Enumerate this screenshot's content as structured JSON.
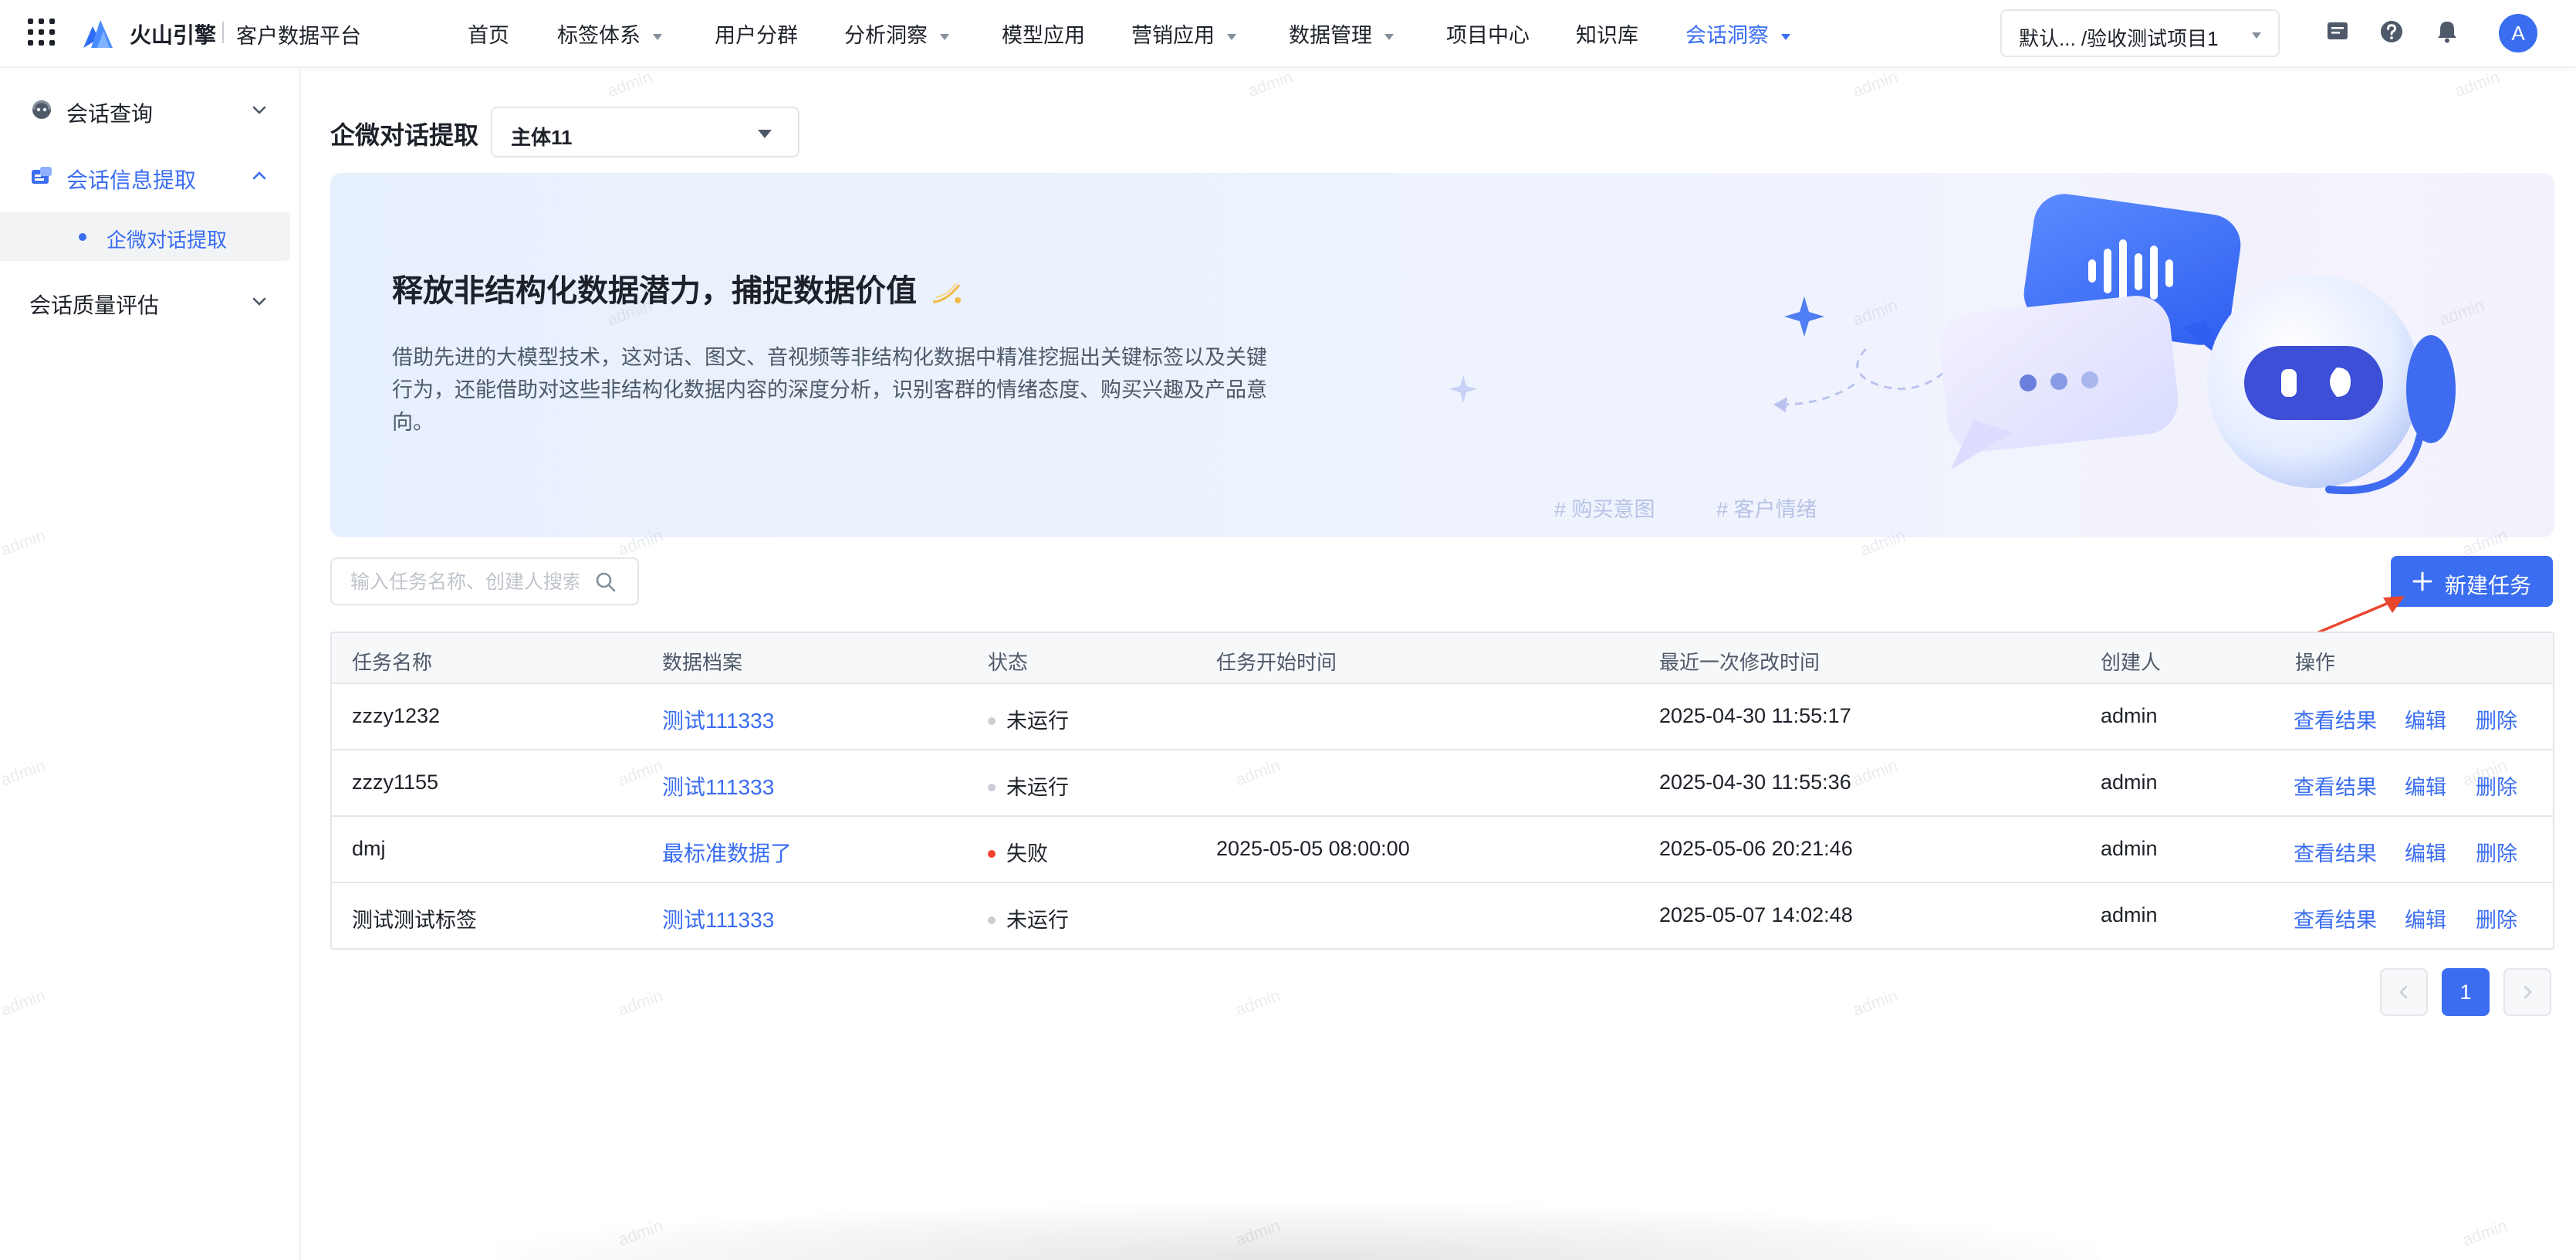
{
  "header": {
    "brand": "火山引擎",
    "platform": "客户数据平台",
    "nav": [
      {
        "label": "首页",
        "dropdown": false
      },
      {
        "label": "标签体系",
        "dropdown": true
      },
      {
        "label": "用户分群",
        "dropdown": false
      },
      {
        "label": "分析洞察",
        "dropdown": true
      },
      {
        "label": "模型应用",
        "dropdown": false
      },
      {
        "label": "营销应用",
        "dropdown": true
      },
      {
        "label": "数据管理",
        "dropdown": true
      },
      {
        "label": "项目中心",
        "dropdown": false
      },
      {
        "label": "知识库",
        "dropdown": false
      },
      {
        "label": "会话洞察",
        "dropdown": true,
        "active": true
      }
    ],
    "project": "默认... /验收测试项目1",
    "avatar": "A",
    "icons": [
      "apps-grid-icon",
      "volcano-logo-icon",
      "message-icon",
      "help-icon",
      "bell-icon"
    ]
  },
  "sidebar": {
    "groups": [
      {
        "label": "会话查询",
        "icon": "chat-headset-icon",
        "expanded": false
      },
      {
        "label": "会话信息提取",
        "icon": "info-extract-icon",
        "expanded": true,
        "children": [
          {
            "label": "企微对话提取",
            "selected": true
          }
        ]
      },
      {
        "label": "会话质量评估",
        "expanded": false
      }
    ]
  },
  "main": {
    "title": "企微对话提取",
    "entity_select": "主体11",
    "banner": {
      "title": "释放非结构化数据潜力，捕捉数据价值",
      "description": "借助先进的大模型技术，这对话、图文、音视频等非结构化数据中精准挖掘出关键标签以及关键行为，还能借助对这些非结构化数据内容的深度分析，识别客群的情绪态度、购买兴趣及产品意向。",
      "tags": [
        "# 购买意图",
        "# 客户情绪"
      ]
    },
    "search": {
      "placeholder": "输入任务名称、创建人搜索",
      "value": ""
    },
    "new_button": "新建任务",
    "table": {
      "columns": [
        "任务名称",
        "数据档案",
        "状态",
        "任务开始时间",
        "最近一次修改时间",
        "创建人",
        "操作"
      ],
      "rows": [
        {
          "name": "zzzy1232",
          "archive": "测试111333",
          "status": "未运行",
          "status_color": "#c9cdd4",
          "start": "",
          "modified": "2025-04-30 11:55:17",
          "creator": "admin"
        },
        {
          "name": "zzzy1155",
          "archive": "测试111333",
          "status": "未运行",
          "status_color": "#c9cdd4",
          "start": "",
          "modified": "2025-04-30 11:55:36",
          "creator": "admin"
        },
        {
          "name": "dmj",
          "archive": "最标准数据了",
          "status": "失败",
          "status_color": "#f5422d",
          "start": "2025-05-05 08:00:00",
          "modified": "2025-05-06 20:21:46",
          "creator": "admin"
        },
        {
          "name": "测试测试标签",
          "archive": "测试111333",
          "status": "未运行",
          "status_color": "#c9cdd4",
          "start": "",
          "modified": "2025-05-07 14:02:48",
          "creator": "admin"
        }
      ],
      "actions": [
        "查看结果",
        "编辑",
        "删除"
      ]
    },
    "pagination": {
      "current": "1"
    }
  },
  "watermark": "admin",
  "colors": {
    "primary": "#3a6df0",
    "text": "#1d2129",
    "muted": "#4e5969",
    "border": "#e5e6eb",
    "fail": "#f5422d",
    "idle": "#c9cdd4"
  }
}
